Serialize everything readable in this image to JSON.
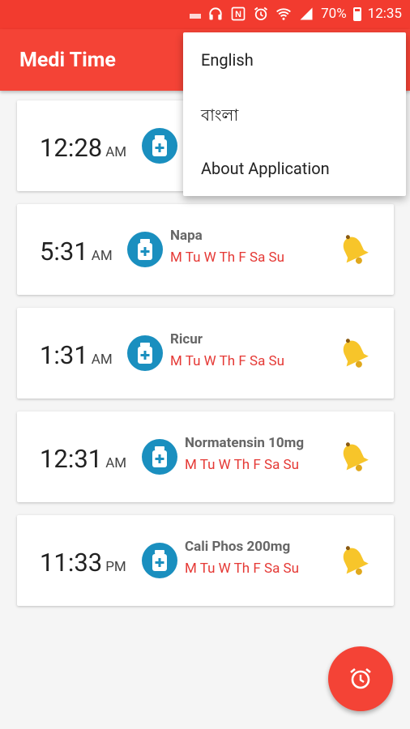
{
  "status_bar": {
    "battery": "70%",
    "time": "12:35"
  },
  "app": {
    "title": "Medi Time"
  },
  "menu": {
    "items": [
      "English",
      "বাংলা",
      "About Application"
    ]
  },
  "alarms": [
    {
      "time": "12:28",
      "ampm": "AM",
      "name": "",
      "days": ""
    },
    {
      "time": "5:31",
      "ampm": "AM",
      "name": "Napa",
      "days": "M Tu W Th F Sa Su"
    },
    {
      "time": "1:31",
      "ampm": "AM",
      "name": "Ricur",
      "days": "M Tu W Th F Sa Su"
    },
    {
      "time": "12:31",
      "ampm": "AM",
      "name": "Normatensin 10mg",
      "days": "M Tu W Th F Sa Su"
    },
    {
      "time": "11:33",
      "ampm": "PM",
      "name": "Cali Phos 200mg",
      "days": "M Tu W Th F Sa Su"
    }
  ],
  "colors": {
    "primary": "#f44336",
    "status_bar": "#f23b2f",
    "accent_days": "#e53935",
    "med_icon": "#1a8fbf",
    "bell": "#f7c52a"
  },
  "icons": {
    "med": "medicine-bottle-icon",
    "bell": "bell-icon",
    "fab": "alarm-clock-icon"
  }
}
